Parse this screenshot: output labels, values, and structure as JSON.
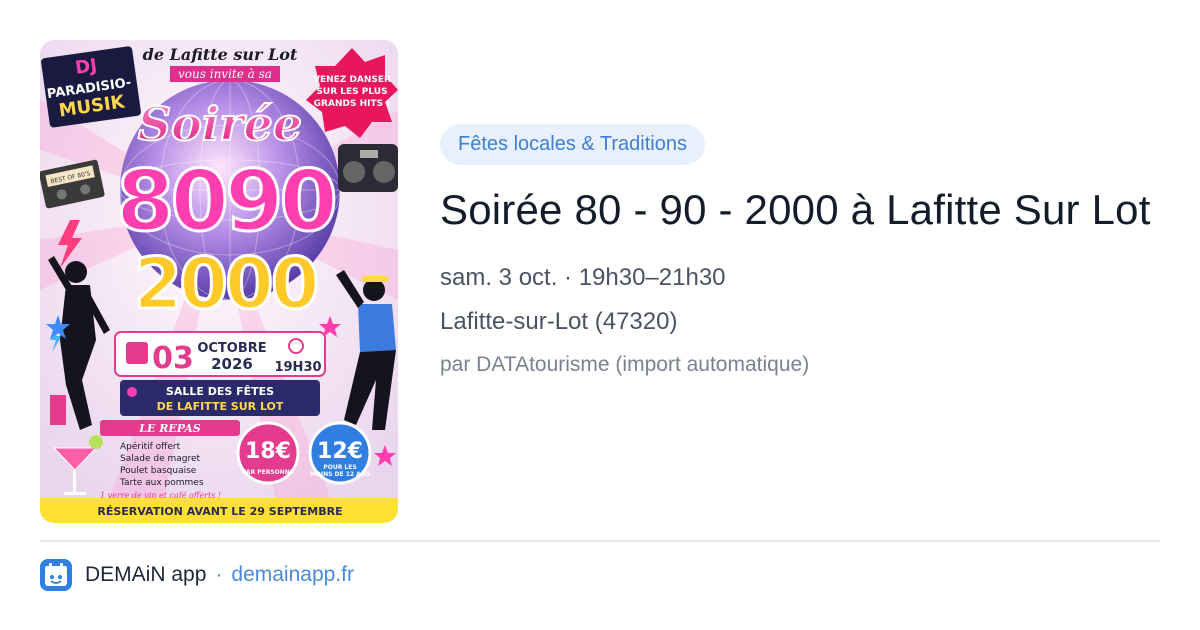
{
  "event": {
    "category": "Fêtes locales & Traditions",
    "title": "Soirée 80 - 90 - 2000 à Lafitte Sur Lot",
    "datetime": "sam. 3 oct. · 19h30–21h30",
    "location": "Lafitte-sur-Lot (47320)",
    "author": "par DATAtourisme (import automatique)"
  },
  "poster": {
    "dj_line1": "DJ",
    "dj_line2": "PARADISIO-",
    "dj_line3": "MUSIK",
    "header_line1": "de Lafitte sur Lot",
    "header_line2": "vous invite à sa",
    "promo_line1": "VENEZ DANSER",
    "promo_line2": "SUR LES PLUS",
    "promo_line3": "GRANDS HITS !",
    "cassette_label": "BEST OF 80'S",
    "word_soiree": "Soirée",
    "word_8090": "8090",
    "word_2000": "2000",
    "day": "03",
    "month": "OCTOBRE",
    "year": "2026",
    "time": "19H30",
    "venue_line1": "SALLE DES FÊTES",
    "venue_line2": "DE LAFITTE SUR LOT",
    "menu_title": "LE REPAS",
    "menu_items": [
      "Apéritif offert",
      "Salade de magret",
      "Poulet basquaise",
      "Tarte aux pommes"
    ],
    "menu_note": "1 verre de vin et café offerts !",
    "price_adult": "18€",
    "price_adult_label": "PAR PERSONNE",
    "price_child": "12€",
    "price_child_label1": "POUR LES",
    "price_child_label2": "MOINS DE 12 ANS",
    "reservation": "RÉSERVATION AVANT LE 29 SEPTEMBRE"
  },
  "footer": {
    "app_name": "DEMAiN app",
    "separator": "·",
    "link": "demainapp.fr"
  },
  "colors": {
    "badge_bg": "#e8f0fb",
    "badge_text": "#3f7fcf",
    "link": "#4c8ad8",
    "app_icon": "#2f7fe0"
  }
}
